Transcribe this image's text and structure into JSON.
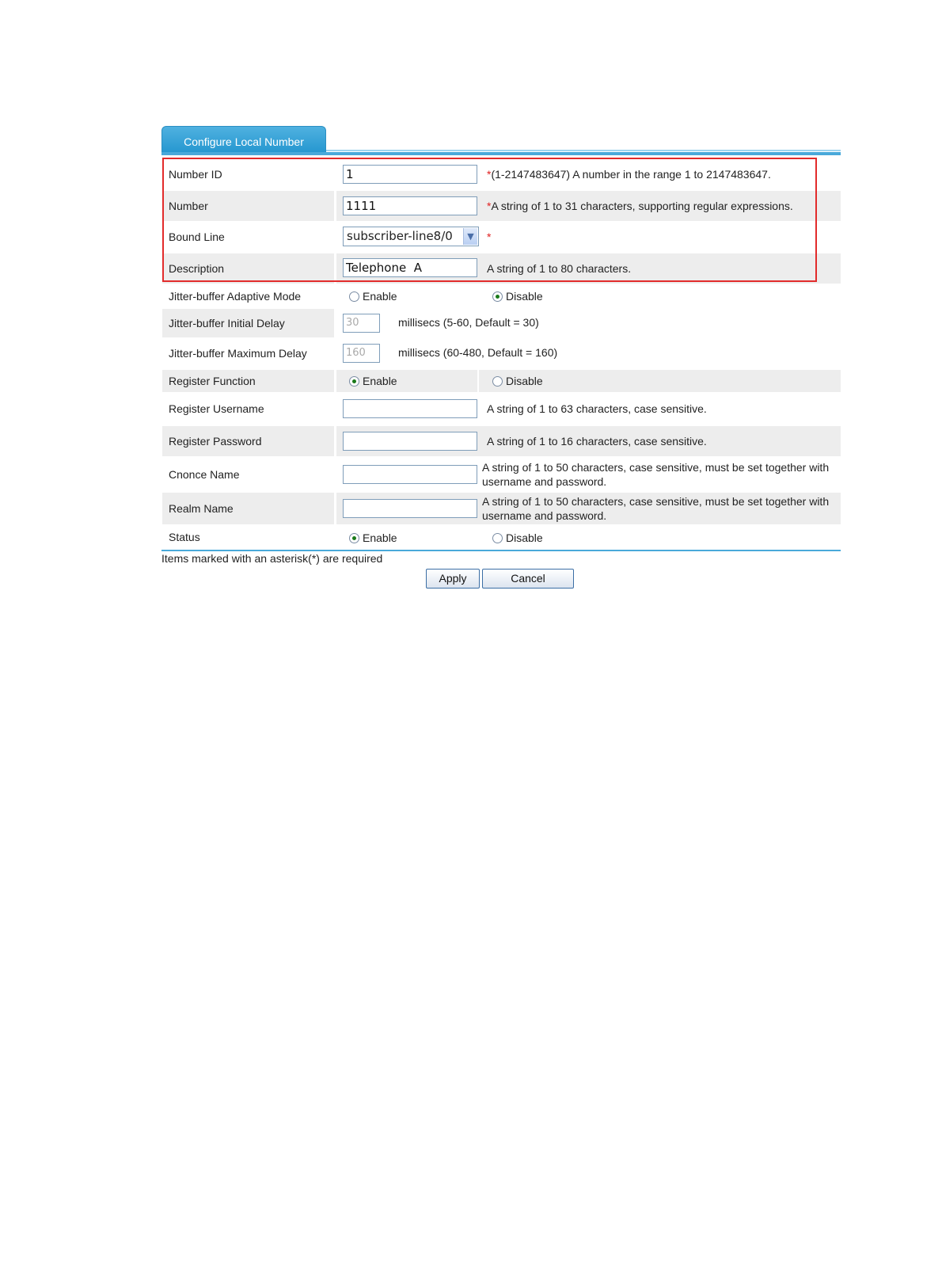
{
  "tab": {
    "title": "Configure Local Number"
  },
  "fields": {
    "number_id": {
      "label": "Number ID",
      "value": "1",
      "hint_star": "*",
      "hint": "(1-2147483647) A number in the range 1 to 2147483647."
    },
    "number": {
      "label": "Number",
      "value": "1111",
      "hint_star": "*",
      "hint": "A string of 1 to 31 characters, supporting regular expressions."
    },
    "bound_line": {
      "label": "Bound Line",
      "value": "subscriber-line8/0",
      "hint_star": "*"
    },
    "description": {
      "label": "Description",
      "value": "Telephone  A",
      "hint": "A string of 1 to 80 characters."
    },
    "jitter_mode": {
      "label": "Jitter-buffer Adaptive Mode",
      "enable": "Enable",
      "disable": "Disable",
      "selected": "Disable"
    },
    "jitter_initial": {
      "label": "Jitter-buffer Initial Delay",
      "value": "30",
      "hint": "millisecs (5-60, Default = 30)"
    },
    "jitter_max": {
      "label": "Jitter-buffer Maximum Delay",
      "value": "160",
      "hint": "millisecs (60-480, Default = 160)"
    },
    "register_function": {
      "label": "Register Function",
      "enable": "Enable",
      "disable": "Disable",
      "selected": "Enable"
    },
    "register_username": {
      "label": "Register Username",
      "value": "",
      "hint": "A string of 1 to 63 characters, case sensitive."
    },
    "register_password": {
      "label": "Register Password",
      "value": "",
      "hint": "A string of 1 to 16 characters, case sensitive."
    },
    "cnonce_name": {
      "label": "Cnonce Name",
      "value": "",
      "hint": "A string of 1 to 50 characters, case sensitive, must be set together with username and password."
    },
    "realm_name": {
      "label": "Realm Name",
      "value": "",
      "hint": "A string of 1 to 50 characters, case sensitive, must be set together with username and password."
    },
    "status": {
      "label": "Status",
      "enable": "Enable",
      "disable": "Disable",
      "selected": "Enable"
    }
  },
  "footer": {
    "note": "Items marked with an asterisk(*) are required",
    "apply_label": "Apply",
    "cancel_label": "Cancel"
  },
  "colors": {
    "tab": "#2496cf",
    "highlight_border": "#e22b2b",
    "required_star": "#e02020"
  }
}
